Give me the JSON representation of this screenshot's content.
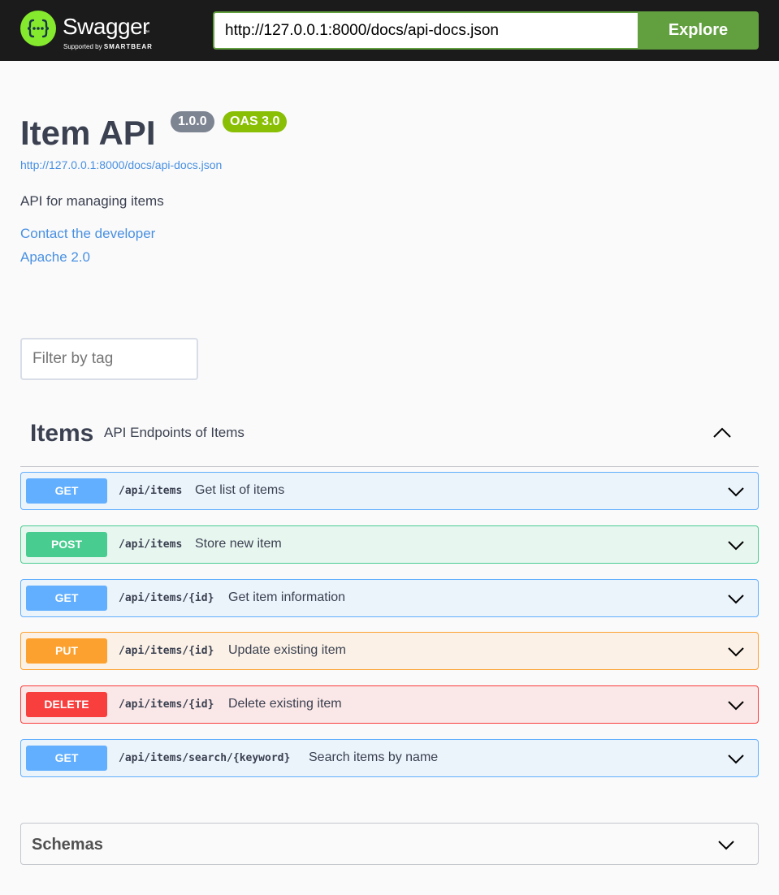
{
  "topbar": {
    "logo_title": "Swagger",
    "logo_tm": "™",
    "logo_sub_prefix": "Supported by",
    "logo_sub_brand": "SMARTBEAR",
    "url_value": "http://127.0.0.1:8000/docs/api-docs.json",
    "explore_label": "Explore",
    "accent": "#62a03f",
    "logo_color": "#85ea2d"
  },
  "info": {
    "title": "Item API",
    "version": "1.0.0",
    "oas": "OAS 3.0",
    "spec_url": "http://127.0.0.1:8000/docs/api-docs.json",
    "description": "API for managing items",
    "contact": "Contact the developer",
    "license": "Apache 2.0"
  },
  "filter": {
    "placeholder": "Filter by tag"
  },
  "tag": {
    "name": "Items",
    "description": "API Endpoints of Items"
  },
  "operations": [
    {
      "method": "GET",
      "path": "/api/items",
      "summary": "Get list of items",
      "color": "#61affe"
    },
    {
      "method": "POST",
      "path": "/api/items",
      "summary": "Store new item",
      "color": "#49cc90"
    },
    {
      "method": "GET",
      "path": "/api/items/{id}",
      "summary": "Get item information",
      "color": "#61affe"
    },
    {
      "method": "PUT",
      "path": "/api/items/{id}",
      "summary": "Update existing item",
      "color": "#fca130"
    },
    {
      "method": "DELETE",
      "path": "/api/items/{id}",
      "summary": "Delete existing item",
      "color": "#f93e3e"
    },
    {
      "method": "GET",
      "path": "/api/items/search/{keyword}",
      "summary": "Search items by name",
      "color": "#61affe"
    }
  ],
  "schemas": {
    "title": "Schemas"
  }
}
